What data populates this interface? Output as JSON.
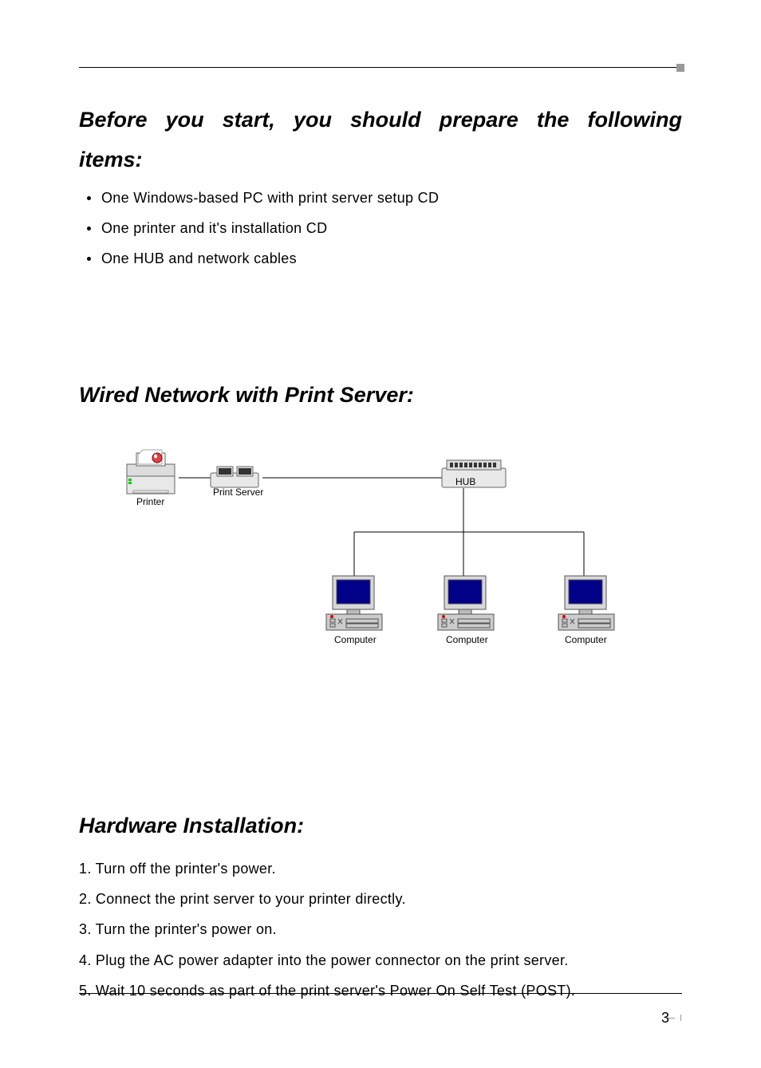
{
  "heading1_line1": "Before you start, you should prepare the following",
  "heading1_line2": "items:",
  "bullets": {
    "b1": "One Windows-based PC with print server setup CD",
    "b2": "One printer and it's installation CD",
    "b3": "One HUB and network cables"
  },
  "heading2": "Wired Network with Print Server:",
  "diagram": {
    "printer": "Printer",
    "printserver": "Print Server",
    "hub": "HUB",
    "computer": "Computer"
  },
  "heading3": "Hardware Installation:",
  "steps": {
    "s1": "Turn off the printer's power.",
    "s2": "Connect the print server to your printer directly.",
    "s3": "Turn the printer's power on.",
    "s4": "Plug the AC power adapter into the power connector on the print server.",
    "s5": "Wait 10 seconds as part of the print server's Power On Self Test (POST)."
  },
  "page": "3"
}
